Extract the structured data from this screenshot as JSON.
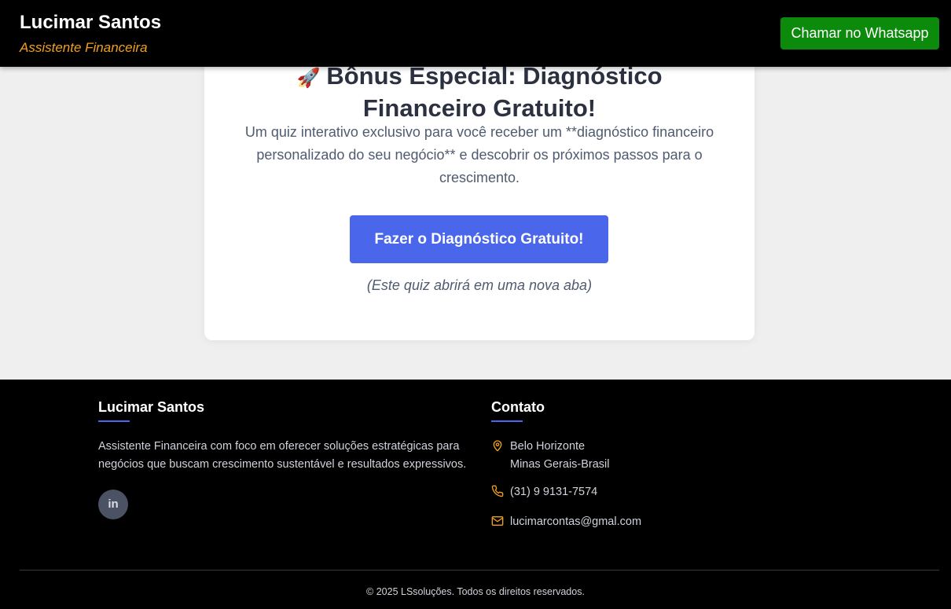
{
  "header": {
    "name": "Lucimar Santos",
    "subtitle": "Assistente Financeira",
    "whatsapp_label": "Chamar no Whatsapp"
  },
  "card": {
    "title_icon": "rocket-icon",
    "title_line1": "Bônus Especial: Diagnóstico",
    "title_line2": "Financeiro Gratuito!",
    "description": "Um quiz interativo exclusivo para você receber um **diagnóstico financeiro personalizado do seu negócio** e descobrir os próximos passos para o crescimento.",
    "cta_label": "Fazer o Diagnóstico Gratuito!",
    "note": "(Este quiz abrirá em uma nova aba)"
  },
  "footer": {
    "about_title": "Lucimar Santos",
    "about_text": "Assistente Financeira com foco em oferecer soluções estratégicas para negócios que buscam crescimento sustentável e resultados expressivos.",
    "social_icon": "linkedin-icon",
    "contact_title": "Contato",
    "location_line1": "Belo Horizonte",
    "location_line2": "Minas Gerais-Brasil",
    "phone": "(31) 9 9131-7574",
    "email": "lucimarcontas@gmal.com",
    "copyright": "© 2025 LSsoluções. Todos os direitos reservados."
  },
  "colors": {
    "header_bg": "#000000",
    "accent_orange": "#f0a020",
    "whatsapp_green": "#0b8a0b",
    "cta_blue": "#4a67ec",
    "page_bg": "#efefef"
  }
}
